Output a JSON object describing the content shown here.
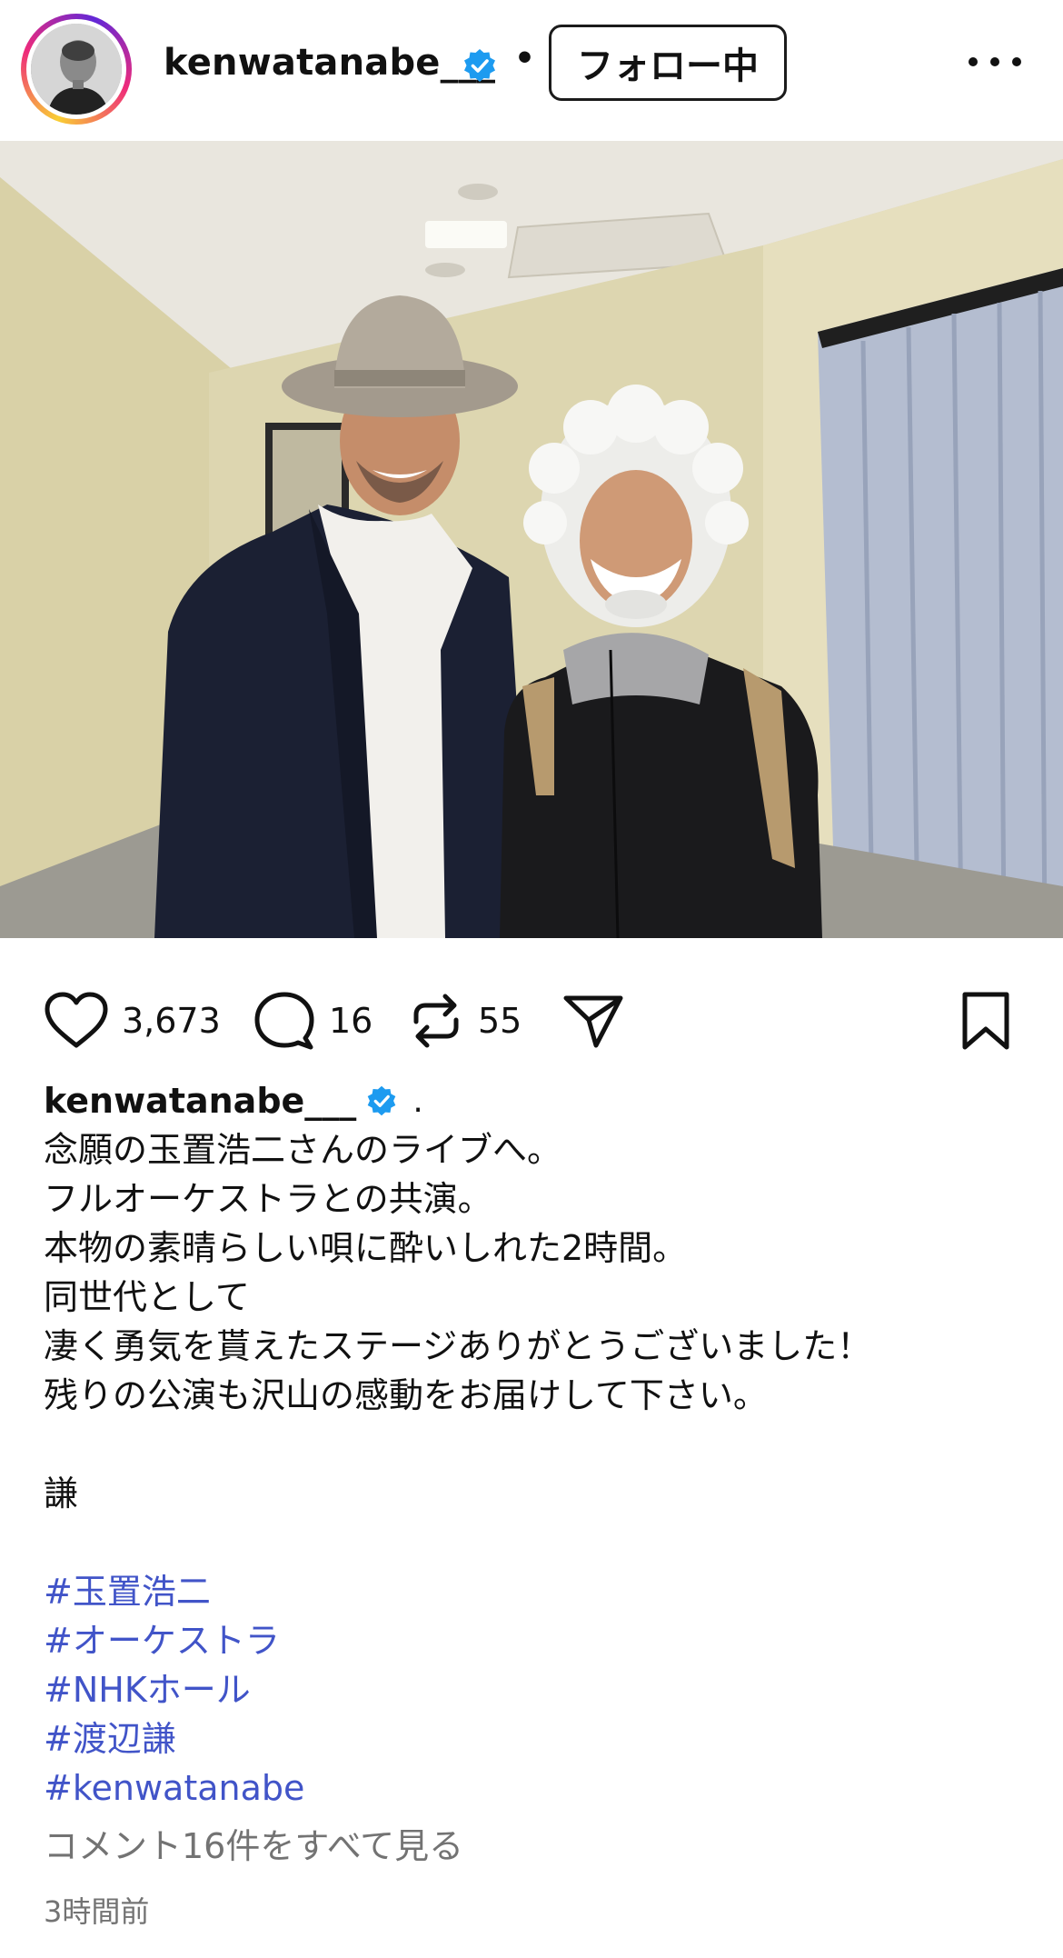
{
  "header": {
    "username": "kenwatanabe___",
    "separator": "•",
    "follow_label": "フォロー中"
  },
  "actions": {
    "likes": "3,673",
    "comments": "16",
    "reposts": "55"
  },
  "caption": {
    "username": "kenwatanabe___",
    "after_badge": ".",
    "lines": [
      "念願の玉置浩二さんのライブへ。",
      "フルオーケストラとの共演。",
      "本物の素晴らしい唄に酔いしれた2時間。",
      "同世代として",
      "凄く勇気を貰えたステージありがとうございました！",
      "残りの公演も沢山の感動をお届けして下さい。"
    ],
    "signature": "謙",
    "hashtags": [
      "#玉置浩二",
      "#オーケストラ",
      "#NHKホール",
      "#渡辺謙",
      "#kenwatanabe"
    ],
    "view_comments": "コメント16件をすべて見る",
    "timestamp": "3時間前"
  },
  "colors": {
    "verified": "#1d9bf0",
    "hashtag": "#4154c8",
    "muted": "#737373",
    "text": "#111111"
  },
  "icons": [
    "verified-badge-icon",
    "heart-icon",
    "comment-bubble-icon",
    "repost-icon",
    "share-send-icon",
    "bookmark-icon",
    "more-options-icon"
  ]
}
